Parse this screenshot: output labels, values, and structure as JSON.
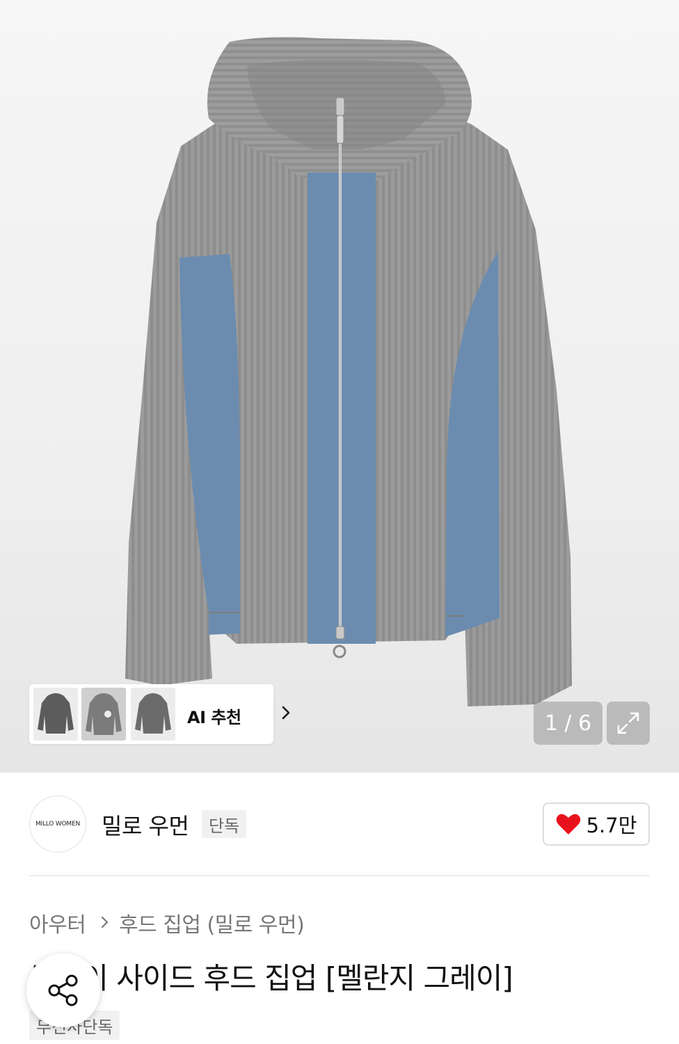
{
  "gallery": {
    "product_image": "gray knit hooded zip-up jacket with blue side panels",
    "counter_text": "1 / 6",
    "current_index": 1,
    "total": 6,
    "expand_icon": "expand-icon"
  },
  "ai_recommendation": {
    "label": "AI 추천",
    "thumbnails": [
      "charcoal-hoodie",
      "gray-hoodie-graphic",
      "gray-hoodie"
    ],
    "arrow_icon": "chevron-right-icon"
  },
  "brand": {
    "logo_text": "MILLO WOMEN",
    "name": "밀로 우먼",
    "badge": "단독"
  },
  "like": {
    "icon": "heart-icon",
    "count": "5.7만",
    "color": "#e8121c"
  },
  "breadcrumb": {
    "category": "아우터",
    "subcategory": "후드 집업 (밀로 우먼)"
  },
  "product": {
    "title": "투웨이 사이드 후드 집업 [멜란지 그레이]",
    "exclusive_badge": "무신사단독"
  },
  "share": {
    "icon": "share-icon"
  }
}
